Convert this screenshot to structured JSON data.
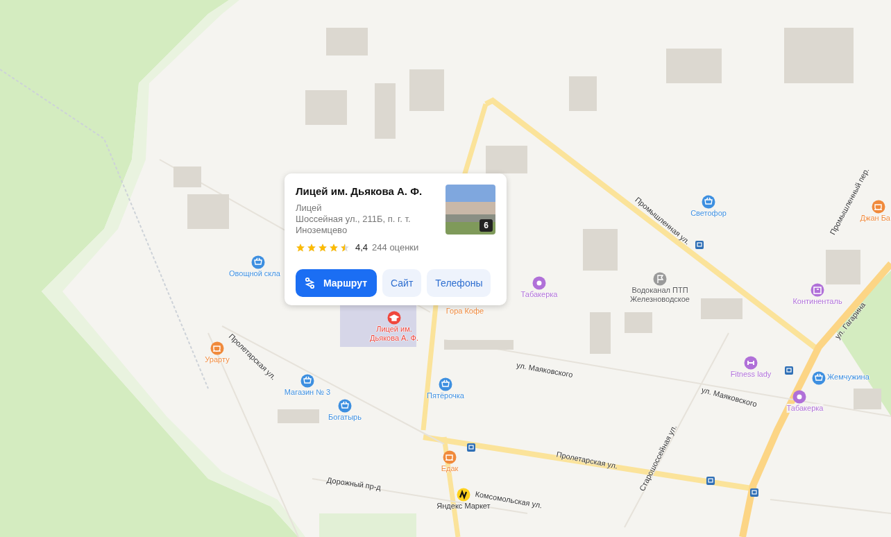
{
  "map": {
    "pois": [
      {
        "name": "Овощной скла",
        "kind": "cart",
        "color": "#3d8fe0"
      },
      {
        "name": "Лицей им.\nДьякова А. Ф.",
        "kind": "school",
        "color": "#f0463c"
      },
      {
        "name": "Гора Кофе",
        "kind": "cup",
        "color": "#f08a3c"
      },
      {
        "name": "Табакерка",
        "kind": "ring",
        "color": "#b070d8"
      },
      {
        "name": "Водоканал ПТП\nЖелезноводское",
        "kind": "flag",
        "color": "#9a9a9a"
      },
      {
        "name": "Светофор",
        "kind": "cart",
        "color": "#3d8fe0"
      },
      {
        "name": "Джан Ба",
        "kind": "cup",
        "color": "#f08a3c"
      },
      {
        "name": "Континенталь",
        "kind": "bank",
        "color": "#b070d8"
      },
      {
        "name": "Урарту",
        "kind": "cup",
        "color": "#f08a3c"
      },
      {
        "name": "Магазин № 3",
        "kind": "cart",
        "color": "#3d8fe0"
      },
      {
        "name": "Богатырь",
        "kind": "cart",
        "color": "#3d8fe0"
      },
      {
        "name": "Пятёрочка",
        "kind": "cart",
        "color": "#3d8fe0"
      },
      {
        "name": "Fitness lady",
        "kind": "gym",
        "color": "#b070d8"
      },
      {
        "name": "Жемчужина",
        "kind": "cart",
        "color": "#3d8fe0"
      },
      {
        "name": "Табакерка",
        "kind": "ring",
        "color": "#b070d8"
      },
      {
        "name": "Едак",
        "kind": "cup",
        "color": "#f08a3c"
      },
      {
        "name": "Яндекс Маркет",
        "kind": "market",
        "color": "#ffd21e"
      }
    ],
    "streets": [
      "Промышленная ул.",
      "Промышленный пер.",
      "ул. Гагарина",
      "ул. Маяковского",
      "ул. Маяковского",
      "Пролетарская ул.",
      "Пролетарская ул.",
      "Старошоссейная ул.",
      "Дорожный пр-д",
      "Комсомольская ул."
    ]
  },
  "card": {
    "title": "Лицей им. Дьякова А. Ф.",
    "category": "Лицей",
    "address": "Шоссейная ул., 211Б, п. г. т. Иноземцево",
    "stars": 4.5,
    "rating": "4,4",
    "reviews": "244 оценки",
    "photo_count": "6",
    "buttons": [
      {
        "label": "Маршрут",
        "kind": "primary"
      },
      {
        "label": "Сайт",
        "kind": "secondary"
      },
      {
        "label": "Телефоны",
        "kind": "secondary"
      }
    ]
  }
}
